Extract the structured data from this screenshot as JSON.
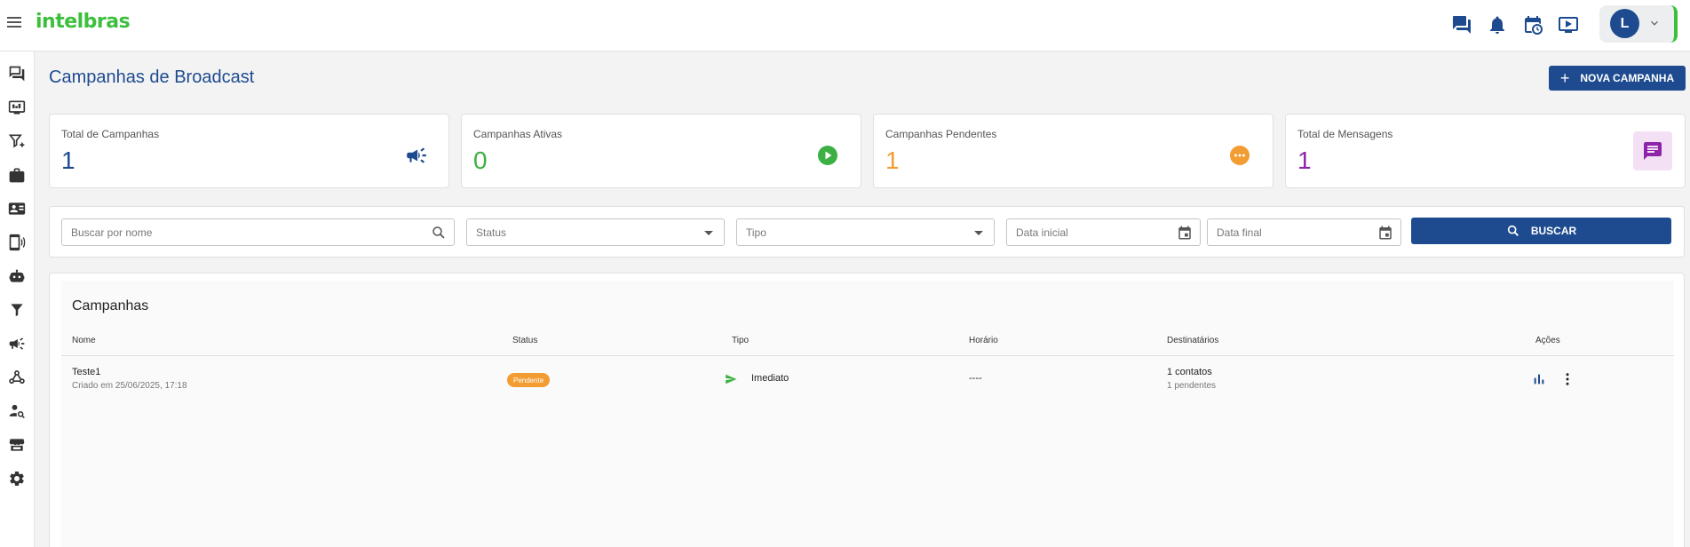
{
  "app": {
    "logo_text": "intelbras"
  },
  "user": {
    "initial": "L"
  },
  "page": {
    "title": "Campanhas de Broadcast",
    "new_button": "NOVA CAMPANHA"
  },
  "stats": [
    {
      "label": "Total de Campanhas",
      "value": "1",
      "color": "#1e4b8f",
      "icon": "megaphone-icon"
    },
    {
      "label": "Campanhas Ativas",
      "value": "0",
      "color": "#3cb043",
      "icon": "play-circle-icon"
    },
    {
      "label": "Campanhas Pendentes",
      "value": "1",
      "color": "#f39c32",
      "icon": "more-circle-icon"
    },
    {
      "label": "Total de Mensagens",
      "value": "1",
      "color": "#8e24aa",
      "icon": "message-icon"
    }
  ],
  "filters": {
    "search_placeholder": "Buscar por nome",
    "status_label": "Status",
    "type_label": "Tipo",
    "start_date_placeholder": "Data inicial",
    "end_date_placeholder": "Data final",
    "search_button": "BUSCAR"
  },
  "table": {
    "title": "Campanhas",
    "columns": [
      "Nome",
      "Status",
      "Tipo",
      "Horário",
      "Destinatários",
      "Ações"
    ],
    "rows": [
      {
        "name": "Teste1",
        "created": "Criado em 25/06/2025, 17:18",
        "status": "Pendente",
        "type": "Imediato",
        "time": "----",
        "recipients": "1 contatos",
        "pending": "1 pendentes"
      }
    ]
  },
  "colors": {
    "primary": "#1e4b8f",
    "brand_green": "#3cbf3c",
    "pending": "#f39c32"
  }
}
